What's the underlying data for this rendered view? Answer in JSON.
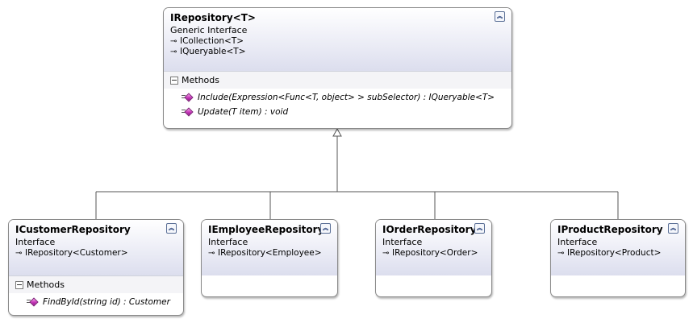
{
  "diagram": {
    "base": {
      "name": "IRepository<T>",
      "stereotype": "Generic Interface",
      "implements": [
        "ICollection<T>",
        "IQueryable<T>"
      ],
      "section_label": "Methods",
      "methods": [
        "Include(Expression<Func<T, object> > subSelector) : IQueryable<T>",
        "Update(T item) : void"
      ]
    },
    "derived": [
      {
        "name": "ICustomerRepository",
        "stereotype": "Interface",
        "implements": "IRepository<Customer>",
        "section_label": "Methods",
        "methods": [
          "FindById(string id) : Customer"
        ]
      },
      {
        "name": "IEmployeeRepository",
        "stereotype": "Interface",
        "implements": "IRepository<Employee>"
      },
      {
        "name": "IOrderRepository",
        "stereotype": "Interface",
        "implements": "IRepository<Order>"
      },
      {
        "name": "IProductRepository",
        "stereotype": "Interface",
        "implements": "IRepository<Product>"
      }
    ],
    "icons": {
      "collapse": "double-chevron-up-icon",
      "section_toggle": "minus-box-icon",
      "implements": "lollipop-arrow-icon",
      "method": "public-method-icon"
    },
    "colors": {
      "header_gradient_top": "#ffffff",
      "header_gradient_bottom": "#dcdeee",
      "border": "#8a8a8a",
      "method_icon": "#c534b8",
      "connector": "#555555"
    }
  }
}
